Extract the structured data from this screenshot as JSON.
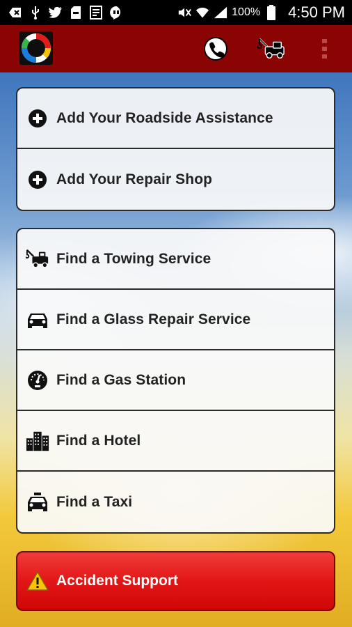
{
  "status_bar": {
    "battery_percent": "100%",
    "time": "4:50 PM",
    "left_icons": [
      "back-notification-icon",
      "usb-icon",
      "twitter-icon",
      "sd-card-icon",
      "gallery-icon",
      "talk-icon"
    ],
    "right_icons": [
      "mute-icon",
      "wifi-icon",
      "signal-icon",
      "battery-icon"
    ]
  },
  "app_bar": {
    "logo_icon": "lifebuoy-logo-icon",
    "actions": [
      {
        "icon": "phone-call-icon"
      },
      {
        "icon": "tow-truck-icon"
      },
      {
        "icon": "overflow-menu-icon"
      }
    ],
    "background_color": "#8a0404"
  },
  "add_section": {
    "items": [
      {
        "label": "Add Your Roadside Assistance",
        "icon": "plus-circle-icon"
      },
      {
        "label": "Add Your Repair Shop",
        "icon": "plus-circle-icon"
      }
    ]
  },
  "find_section": {
    "items": [
      {
        "label": "Find a Towing Service",
        "icon": "tow-truck-icon"
      },
      {
        "label": "Find a Glass Repair Service",
        "icon": "car-icon"
      },
      {
        "label": "Find a Gas Station",
        "icon": "gauge-icon"
      },
      {
        "label": "Find a Hotel",
        "icon": "buildings-icon"
      },
      {
        "label": "Find a Taxi",
        "icon": "taxi-icon"
      }
    ]
  },
  "accident": {
    "label": "Accident Support",
    "icon": "warning-icon",
    "background_color": "#e31616"
  }
}
